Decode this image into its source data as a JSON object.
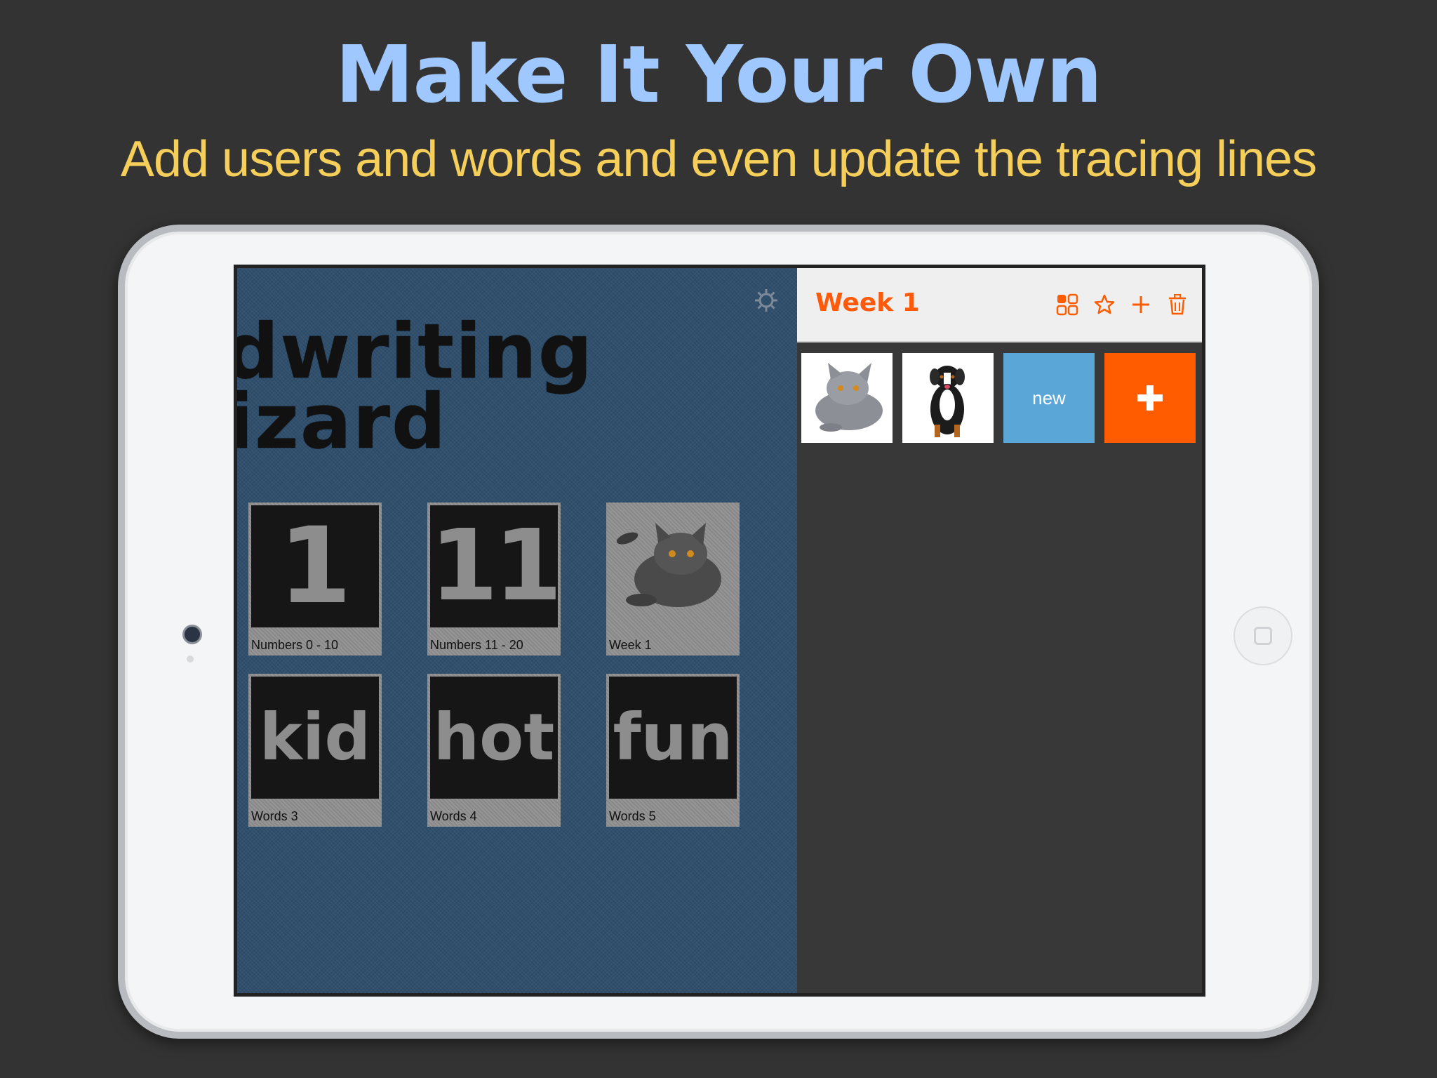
{
  "promo": {
    "headline": "Make It Your Own",
    "subhead": "Add users and words and even update the tracing lines"
  },
  "app": {
    "title_line1": "dwriting",
    "title_line2": "izard",
    "settings_icon": "gear-icon",
    "lists": [
      {
        "label": "Numbers 0 - 10",
        "glyph": "1"
      },
      {
        "label": "Numbers 11 - 20",
        "glyph": "11"
      },
      {
        "label": "Week 1",
        "glyph": ""
      },
      {
        "label": "Words 3",
        "glyph": "kid"
      },
      {
        "label": "Words 4",
        "glyph": "hot"
      },
      {
        "label": "Words 5",
        "glyph": "fun"
      }
    ]
  },
  "panel": {
    "title": "Week 1",
    "icons": [
      "grid-icon",
      "star-icon",
      "plus-icon",
      "trash-icon"
    ],
    "items": [
      {
        "kind": "cat-image"
      },
      {
        "kind": "dog-image"
      },
      {
        "kind": "new",
        "label": "new"
      },
      {
        "kind": "add"
      }
    ],
    "accent": "#ff5c00",
    "new_color": "#5aa6d6"
  }
}
